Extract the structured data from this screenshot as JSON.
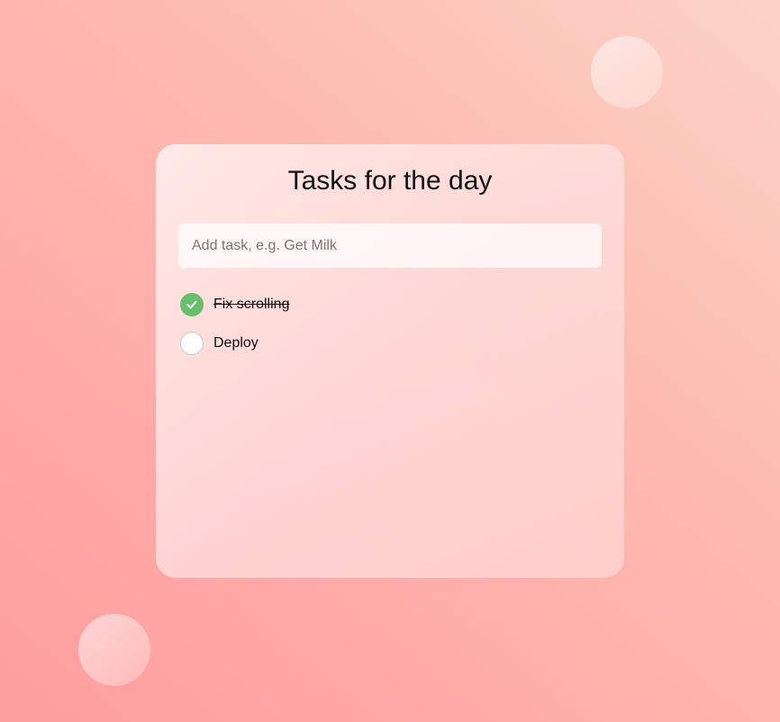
{
  "page": {
    "title": "Tasks for the day"
  },
  "input": {
    "placeholder": "Add task, e.g. Get Milk",
    "value": ""
  },
  "tasks": [
    {
      "label": "Fix scrolling",
      "completed": true
    },
    {
      "label": "Deploy",
      "completed": false
    }
  ],
  "colors": {
    "check_done": "#67bf6b",
    "background_start": "#ff9c9e",
    "background_end": "#fbd3c6"
  },
  "icons": {
    "done": "checkmark-icon"
  }
}
